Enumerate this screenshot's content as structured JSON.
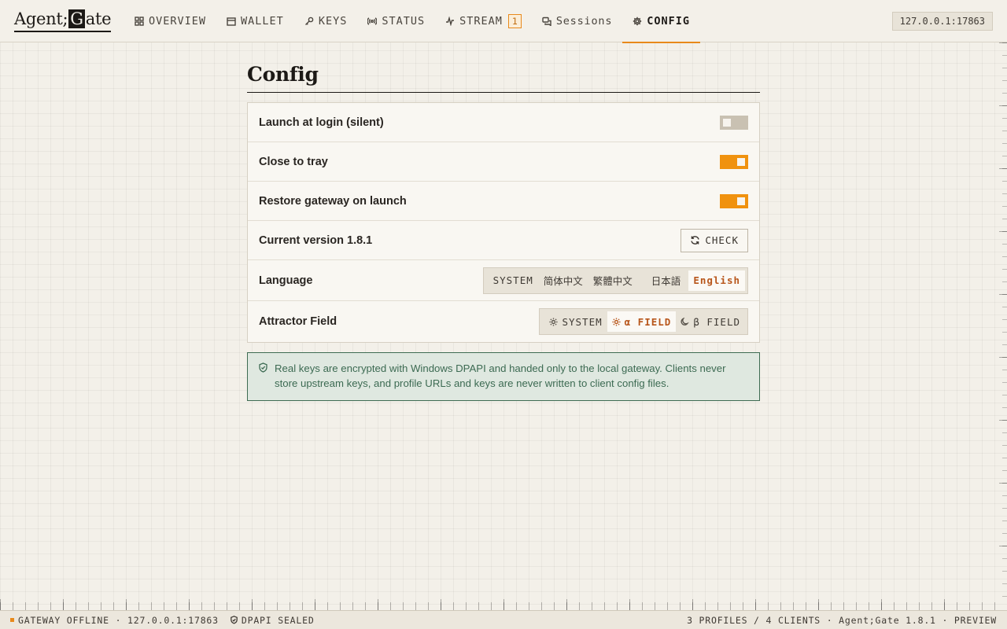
{
  "brand": {
    "logo_prefix": "Agent;",
    "logo_box_letter": "G",
    "logo_suffix": "ate"
  },
  "nav": {
    "items": [
      {
        "label": "OVERVIEW",
        "icon": "grid-icon"
      },
      {
        "label": "WALLET",
        "icon": "wallet-icon"
      },
      {
        "label": "KEYS",
        "icon": "key-icon"
      },
      {
        "label": "STATUS",
        "icon": "signal-icon"
      },
      {
        "label": "STREAM",
        "icon": "pulse-icon",
        "badge": "1"
      },
      {
        "label": "Sessions",
        "icon": "chat-icon"
      },
      {
        "label": "CONFIG",
        "icon": "gear-icon",
        "active": true
      }
    ],
    "address": "127.0.0.1:17863"
  },
  "page": {
    "title": "Config"
  },
  "settings": {
    "launch_at_login": {
      "label": "Launch at login (silent)",
      "enabled": false
    },
    "close_to_tray": {
      "label": "Close to tray",
      "enabled": true
    },
    "restore_gateway": {
      "label": "Restore gateway on launch",
      "enabled": true
    },
    "version": {
      "label": "Current version 1.8.1",
      "check_label": "CHECK"
    },
    "language": {
      "label": "Language",
      "options": [
        "SYSTEM",
        "简体中文",
        "繁體中文",
        "日本語",
        "English"
      ],
      "selected": "English"
    },
    "attractor": {
      "label": "Attractor Field",
      "options": [
        "SYSTEM",
        "α FIELD",
        "β FIELD"
      ],
      "selected": "α FIELD"
    }
  },
  "notice": {
    "text": "Real keys are encrypted with Windows DPAPI and handed only to the local gateway. Clients never store upstream keys, and profile URLs and keys are never written to client config files."
  },
  "footer": {
    "gateway_status": "GATEWAY OFFLINE · 127.0.0.1:17863",
    "dpapi": "DPAPI SEALED",
    "summary": "3 PROFILES / 4 CLIENTS · Agent;Gate 1.8.1 · PREVIEW"
  },
  "colors": {
    "accent": "#f0920f",
    "notice_green": "#3c6a52",
    "background": "#f3f0e9"
  }
}
